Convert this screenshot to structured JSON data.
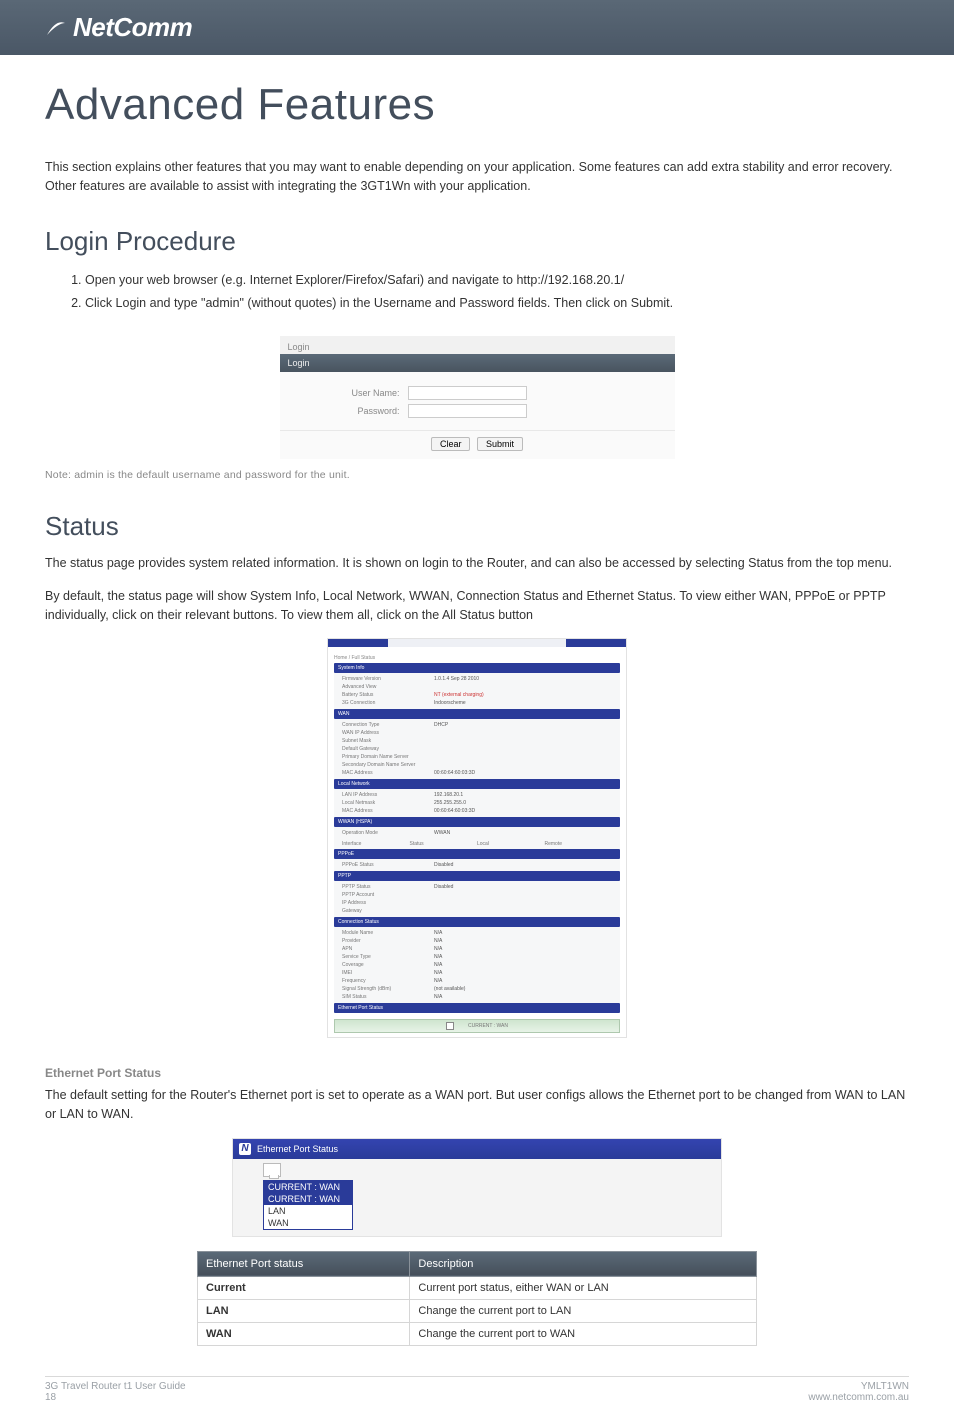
{
  "brand": "NetComm",
  "main_title": "Advanced Features",
  "intro_text": "This section explains other features that you may want to enable depending on your application. Some features can add extra stability and error recovery. Other features are available to assist with integrating the 3GT1Wn with your application.",
  "login": {
    "heading": "Login Procedure",
    "steps": [
      "Open your web browser (e.g. Internet Explorer/Firefox/Safari) and navigate to http://192.168.20.1/",
      "Click Login and type \"admin\" (without quotes) in the Username and Password fields. Then click on Submit."
    ],
    "screenshot": {
      "top_label": "Login",
      "tab_label": "Login",
      "username_label": "User Name:",
      "password_label": "Password:",
      "clear_btn": "Clear",
      "submit_btn": "Submit"
    },
    "note": "Note: admin is the default username and password for the unit."
  },
  "status": {
    "heading": "Status",
    "para1": "The status page provides system related information. It is shown on login to the Router, and can also be accessed by selecting Status from the top menu.",
    "para2": "By default, the status page will show System Info, Local Network, WWAN, Connection Status and Ethernet Status. To view either WAN, PPPoE or PPTP individually, click on their relevant buttons. To view them all, click on the All Status button",
    "screenshot": {
      "breadcrumb": "Home / Full Status",
      "sections": {
        "system_info": {
          "title": "System Info",
          "rows": [
            [
              "Firmware Version",
              "1.0.1.4 Sep 28 2010"
            ],
            [
              "Advanced View",
              ""
            ],
            [
              "Battery Status",
              "NT (external charging)"
            ],
            [
              "3G Connection",
              "Indoorscheme"
            ]
          ]
        },
        "wan": {
          "title": "WAN",
          "rows": [
            [
              "Connection Type",
              "DHCP"
            ],
            [
              "WAN IP Address",
              ""
            ],
            [
              "Subnet Mask",
              ""
            ],
            [
              "Default Gateway",
              ""
            ],
            [
              "Primary Domain Name Server",
              ""
            ],
            [
              "Secondary Domain Name Server",
              ""
            ],
            [
              "MAC Address",
              "00:60:64:60:03:3D"
            ]
          ]
        },
        "local_network": {
          "title": "Local Network",
          "rows": [
            [
              "LAN IP Address",
              "192.168.20.1"
            ],
            [
              "Local Netmask",
              "255.255.255.0"
            ],
            [
              "MAC Address",
              "00:60:64:60:03:3D"
            ]
          ]
        },
        "wwan_hspa": {
          "title": "WWAN (HSPA)",
          "rows": [
            [
              "Operation Mode",
              "WWAN"
            ]
          ],
          "columns": [
            "Interface",
            "Status",
            "Local",
            "Remote"
          ]
        },
        "pppoe": {
          "title": "PPPoE",
          "rows": [
            [
              "PPPoE Status",
              "Disabled"
            ]
          ]
        },
        "pptp": {
          "title": "PPTP",
          "rows": [
            [
              "PPTP Status",
              "Disabled"
            ],
            [
              "PPTP Account",
              ""
            ],
            [
              "IP Address",
              ""
            ],
            [
              "Gateway",
              ""
            ]
          ]
        },
        "connection_status": {
          "title": "Connection Status",
          "rows": [
            [
              "Module Name",
              "N/A"
            ],
            [
              "Provider",
              "N/A"
            ],
            [
              "APN",
              "N/A"
            ],
            [
              "Service Type",
              "N/A"
            ],
            [
              "Coverage",
              "N/A"
            ],
            [
              "IMEI",
              "N/A"
            ],
            [
              "Frequency",
              "N/A"
            ],
            [
              "Signal Strength (dBm)",
              "(not available)"
            ],
            [
              "SIM Status",
              "N/A"
            ]
          ]
        },
        "ethernet_port_status_bar": "Ethernet Port Status",
        "footer_option": "CURRENT : WAN"
      }
    }
  },
  "eth_section": {
    "heading": "Ethernet Port Status",
    "para": "The default setting for the Router's Ethernet port is set to operate as a WAN port. But user configs allows the Ethernet port to be changed from WAN to LAN or LAN to WAN.",
    "screenshot": {
      "panel_title": "Ethernet Port Status",
      "selected": "CURRENT : WAN",
      "options": [
        "CURRENT : WAN",
        "LAN",
        "WAN"
      ]
    },
    "table": {
      "header_left": "Ethernet Port status",
      "header_right": "Description",
      "rows": [
        [
          "Current",
          "Current port status, either WAN or LAN"
        ],
        [
          "LAN",
          "Change the current port to LAN"
        ],
        [
          "WAN",
          "Change the current port to WAN"
        ]
      ]
    }
  },
  "footer": {
    "left_title": "3G Travel Router t1 User Guide",
    "left_page": "18",
    "right_code": "YMLT1WN",
    "right_url": "www.netcomm.com.au"
  }
}
